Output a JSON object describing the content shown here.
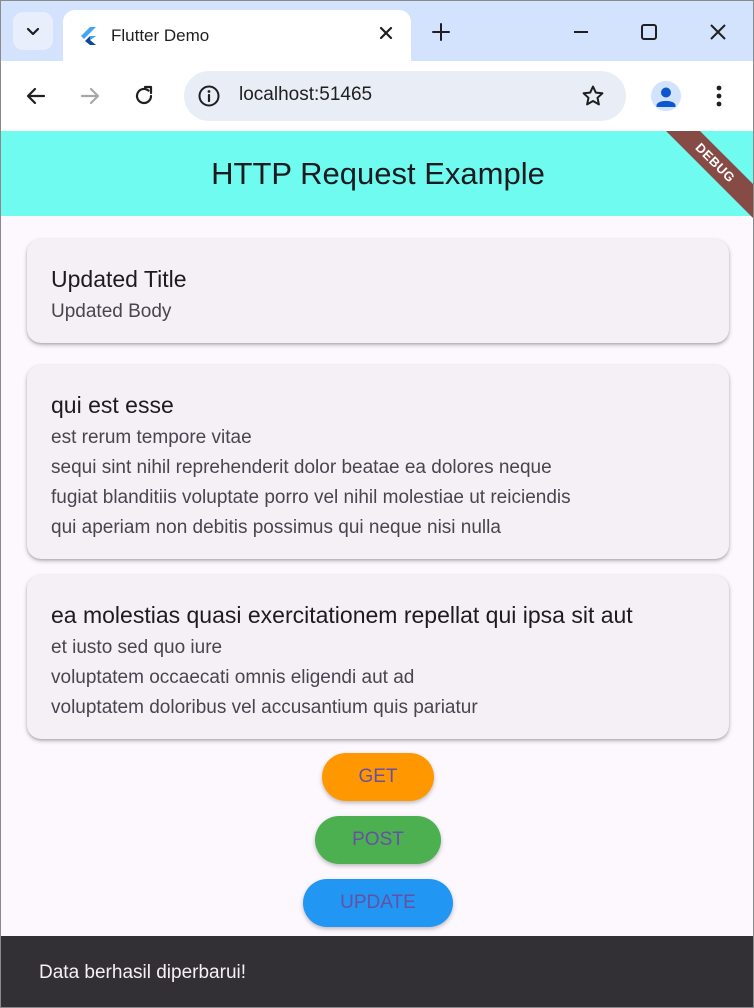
{
  "browser": {
    "tab_title": "Flutter Demo",
    "url": "localhost:51465"
  },
  "app": {
    "title": "HTTP Request Example",
    "debug_banner": "DEBUG",
    "appbar_color": "#6ffbf0",
    "posts": [
      {
        "title": "Updated Title",
        "body": "Updated Body"
      },
      {
        "title": "qui est esse",
        "body": "est rerum tempore vitae\nsequi sint nihil reprehenderit dolor beatae ea dolores neque\nfugiat blanditiis voluptate porro vel nihil molestiae ut reiciendis\nqui aperiam non debitis possimus qui neque nisi nulla"
      },
      {
        "title": "ea molestias quasi exercitationem repellat qui ipsa sit aut",
        "body": "et iusto sed quo iure\nvoluptatem occaecati omnis eligendi aut ad\nvoluptatem doloribus vel accusantium quis pariatur"
      }
    ],
    "buttons": [
      {
        "label": "GET",
        "color": "#ff9800"
      },
      {
        "label": "POST",
        "color": "#4caf50"
      },
      {
        "label": "UPDATE",
        "color": "#2196f3"
      }
    ],
    "snackbar": "Data berhasil diperbarui!"
  },
  "icons": {
    "tab_search": "chevron-down-icon",
    "favicon": "flutter-icon",
    "tab_close": "close-icon",
    "new_tab": "plus-icon",
    "minimize": "minimize-icon",
    "maximize": "maximize-icon",
    "window_close": "close-icon",
    "back": "arrow-left-icon",
    "forward": "arrow-right-icon",
    "reload": "reload-icon",
    "site_info": "info-icon",
    "bookmark": "star-icon",
    "profile": "avatar-icon",
    "menu": "kebab-menu-icon"
  }
}
